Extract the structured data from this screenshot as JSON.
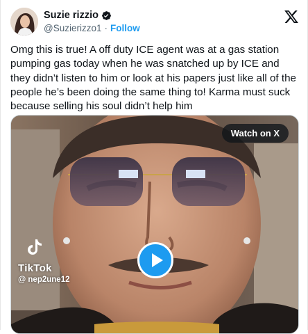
{
  "post": {
    "author_name": "Suzie rizzio",
    "handle": "@Suzierizzo1",
    "separator": "·",
    "follow_label": "Follow",
    "text": "Omg this is true! A off duty ICE agent was at a gas station pumping gas today when he was snatched up by ICE and they didn’t listen to him or look at his papers just like all of the people he’s been doing the same thing to! Karma must suck because selling his soul didn’t help him"
  },
  "media": {
    "watch_label": "Watch on X",
    "watermark_brand": "TikTok",
    "watermark_user": "@ nep2une12"
  },
  "icons": {
    "verified": "verified-badge-icon",
    "x_logo": "x-logo-icon",
    "play": "play-icon",
    "tiktok": "tiktok-logo-icon"
  },
  "colors": {
    "accent": "#1d9bf0",
    "text": "#0f1419",
    "secondary": "#536471"
  }
}
